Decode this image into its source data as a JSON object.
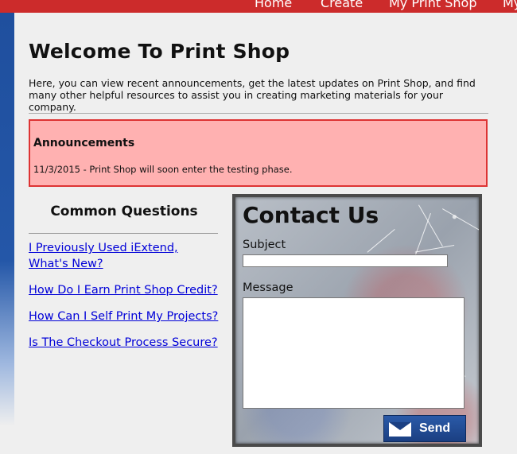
{
  "nav": {
    "items": [
      "Home",
      "Create",
      "My Print Shop",
      "My"
    ]
  },
  "page": {
    "title": "Welcome To Print Shop",
    "intro": "Here, you can view recent announcements, get the latest updates on Print Shop, and find many other helpful resources to assist you in creating marketing materials for your company."
  },
  "announcements": {
    "heading": "Announcements",
    "items": [
      "11/3/2015 - Print Shop will soon enter the testing phase."
    ]
  },
  "faq": {
    "heading": "Common Questions",
    "links": [
      "I Previously Used iExtend, What's New?",
      "How Do I Earn Print Shop Credit?",
      "How Can I Self Print My Projects?",
      "Is The Checkout Process Secure?"
    ]
  },
  "contact": {
    "heading": "Contact Us",
    "subject_label": "Subject",
    "subject_value": "",
    "message_label": "Message",
    "message_value": "",
    "send_label": "Send"
  },
  "colors": {
    "nav_bg": "#cc2b2b",
    "side_stripe": "#1f4f9e",
    "announce_bg": "#ffb1b1",
    "announce_border": "#dd3333",
    "link": "#0000d8",
    "send_btn": "#1b3f82"
  }
}
